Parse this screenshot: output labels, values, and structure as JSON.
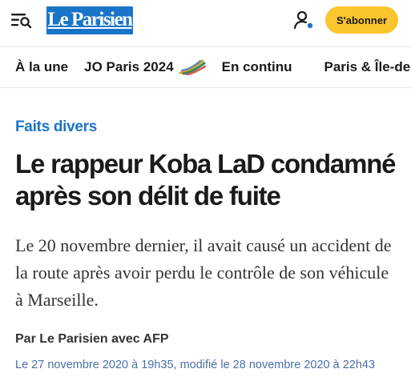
{
  "header": {
    "logo_text": "Le Parisien",
    "subscribe_label": "S'abonner",
    "icons": [
      "menu-search-icon",
      "user-icon"
    ],
    "brand_color": "#1a74c8",
    "accent_color": "#fbc52d"
  },
  "nav": {
    "items": [
      {
        "label": "À la une"
      },
      {
        "label": "JO Paris 2024",
        "icon": "olympic-flame-icon"
      },
      {
        "label": "En continu"
      },
      {
        "label": "Paris & Île-de-"
      }
    ]
  },
  "article": {
    "rubric": "Faits divers",
    "title": "Le rappeur Koba LaD condamné après son délit de fuite",
    "lede": "Le 20 novembre dernier, il avait causé un accident de la route après avoir perdu le contrôle de son véhicule à Marseille.",
    "byline": "Par Le Parisien avec AFP",
    "dateline": "Le 27 novembre 2020 à 19h35, modifié le 28 novembre 2020 à 22h43"
  }
}
